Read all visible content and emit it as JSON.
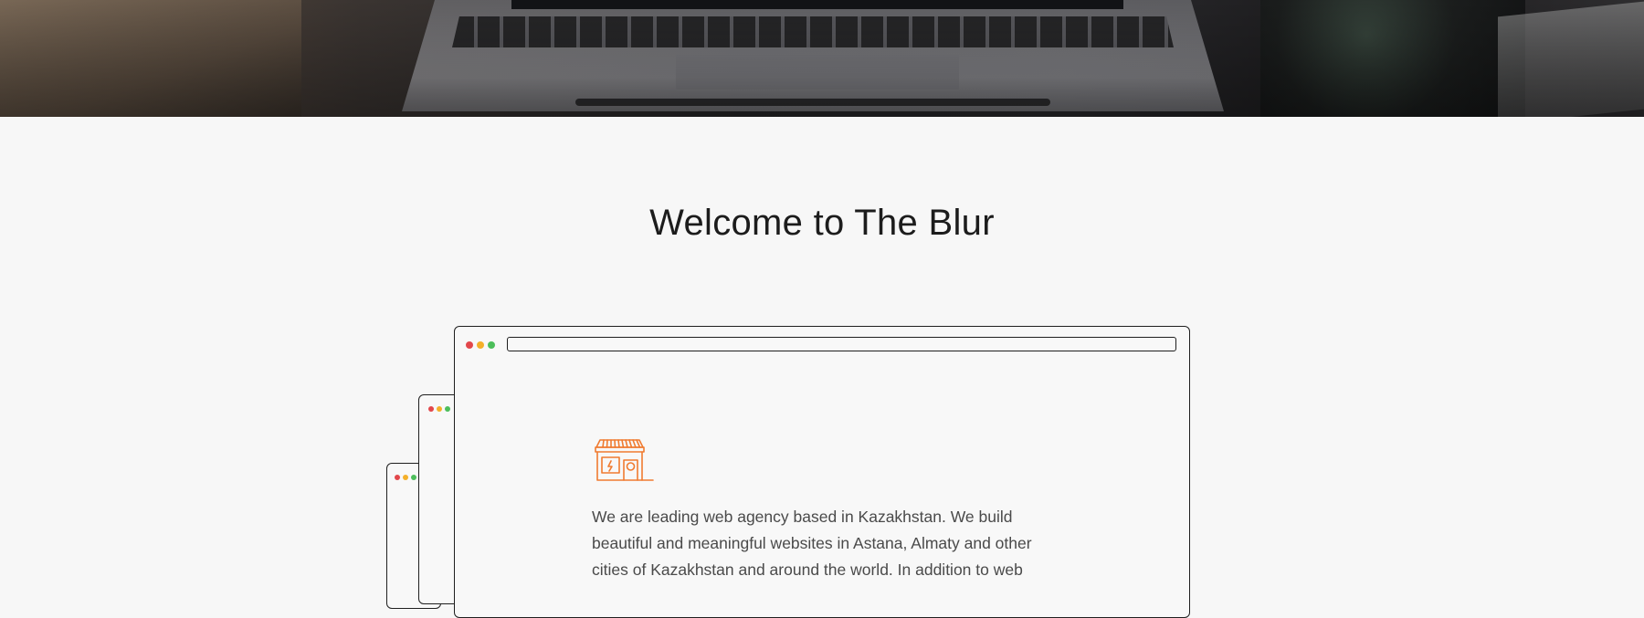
{
  "hero": {
    "image": "laptop-on-desk-background"
  },
  "welcome": {
    "title": "Welcome to The Blur"
  },
  "illustration": {
    "window_dot_colors": [
      "#e2474b",
      "#f4b02a",
      "#4cbe5a"
    ],
    "icon": "storefront-icon",
    "icon_color": "#f07b30"
  },
  "intro": {
    "text": "We are leading web agency based in Kazakhstan. We build beautiful and meaningful websites in Astana, Almaty and other cities of Kazakhstan and around the world. In addition to web"
  }
}
